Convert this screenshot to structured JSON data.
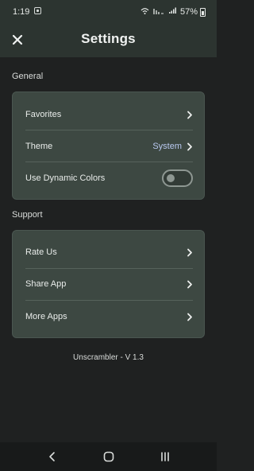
{
  "status_bar": {
    "time": "1:19",
    "battery": "57%",
    "icons": [
      "notification-icon",
      "wifi-calling-icon",
      "lte-icon",
      "signal-icon",
      "battery-icon"
    ]
  },
  "header": {
    "title": "Settings",
    "close_icon": "close-icon"
  },
  "sections": {
    "general": {
      "label": "General",
      "favorites": "Favorites",
      "theme": "Theme",
      "theme_value": "System",
      "dynamic_colors": "Use Dynamic Colors",
      "dynamic_colors_on": false
    },
    "support": {
      "label": "Support",
      "rate_us": "Rate Us",
      "share_app": "Share App",
      "more_apps": "More Apps"
    }
  },
  "footer": {
    "version": "Unscrambler - V 1.3"
  },
  "colors": {
    "background": "#1f2121",
    "app_bar": "#2c3430",
    "card": "#3d4842",
    "accent_value": "#b9c9f0"
  },
  "nav_bar": {
    "icons": [
      "back-icon",
      "home-icon",
      "recents-icon"
    ]
  }
}
